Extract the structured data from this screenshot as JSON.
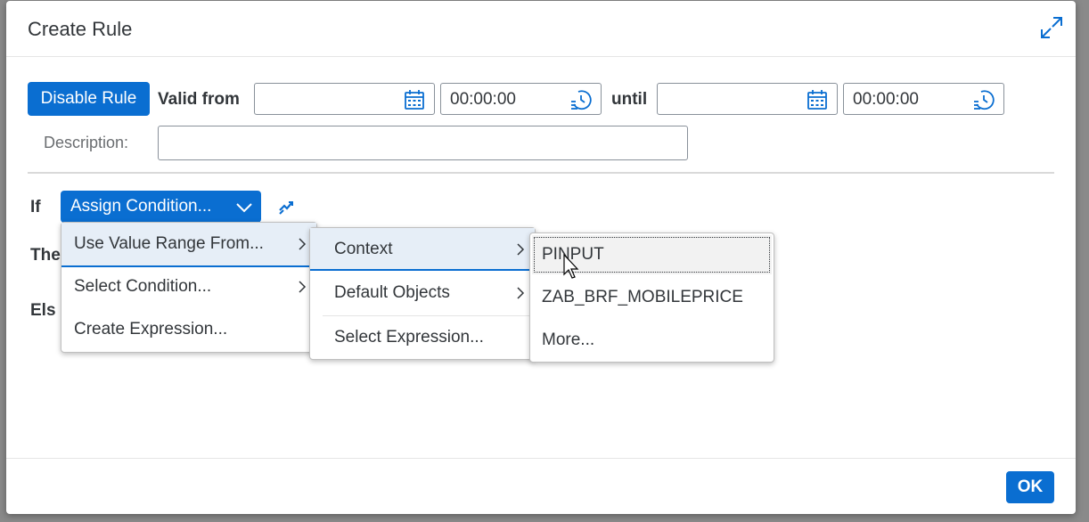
{
  "dialog": {
    "title": "Create Rule",
    "expand_icon": "expand-icon"
  },
  "toolbar": {
    "disable_rule_label": "Disable Rule",
    "valid_from_label": "Valid from",
    "valid_from_date": "",
    "valid_from_time": "00:00:00",
    "until_label": "until",
    "until_date": "",
    "until_time": "00:00:00",
    "calendar_icon": "calendar-icon",
    "clock_icon": "clock-icon"
  },
  "description": {
    "label": "Description:",
    "value": ""
  },
  "rule": {
    "if_label": "If",
    "then_label": "The",
    "else_label": "Els",
    "assign_condition_label": "Assign Condition...",
    "switch_icon": "switch-icon"
  },
  "menu1": {
    "items": [
      {
        "label": "Use Value Range From...",
        "has_submenu": true
      },
      {
        "label": "Select Condition...",
        "has_submenu": true
      },
      {
        "label": "Create Expression...",
        "has_submenu": false
      }
    ]
  },
  "menu2": {
    "items": [
      {
        "label": "Context",
        "has_submenu": true
      },
      {
        "label": "Default Objects",
        "has_submenu": true
      },
      {
        "label": "Select Expression...",
        "has_submenu": false
      }
    ]
  },
  "menu3": {
    "items": [
      {
        "label": "PINPUT"
      },
      {
        "label": "ZAB_BRF_MOBILEPRICE"
      },
      {
        "label": "More..."
      }
    ]
  },
  "footer": {
    "ok_label": "OK"
  },
  "colors": {
    "accent": "#0a6ed1",
    "text": "#32363a"
  }
}
